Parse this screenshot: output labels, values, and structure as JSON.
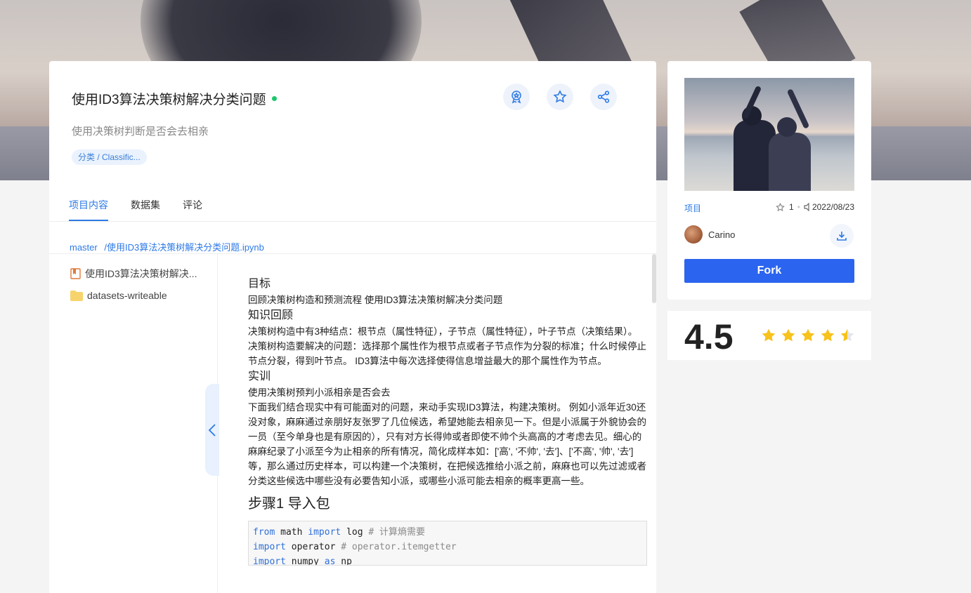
{
  "project": {
    "title": "使用ID3算法决策树解决分类问题",
    "subtitle": "使用决策树判断是否会去相亲",
    "tag": "分类 / Classific...",
    "status_color": "#1bc76b"
  },
  "tabs": [
    {
      "label": "项目内容",
      "active": true
    },
    {
      "label": "数据集",
      "active": false
    },
    {
      "label": "评论",
      "active": false
    }
  ],
  "breadcrumb": {
    "branch": "master",
    "path": "/使用ID3算法决策树解决分类问题.ipynb"
  },
  "file_tree": [
    {
      "icon": "notebook-file-icon",
      "label": "使用ID3算法决策树解决..."
    },
    {
      "icon": "folder-icon",
      "label": "datasets-writeable"
    }
  ],
  "notebook": {
    "h_goal": "目标",
    "goal_text": "回顾决策树构造和预测流程 使用ID3算法决策树解决分类问题",
    "h_knowledge": "知识回顾",
    "knowledge_text": "决策树构造中有3种结点：根节点（属性特征），子节点（属性特征），叶子节点（决策结果）。 决策树构造要解决的问题：选择那个属性作为根节点或者子节点作为分裂的标准；什么时候停止节点分裂，得到叶节点。 ID3算法中每次选择使得信息增益最大的那个属性作为节点。",
    "h_practice": "实训",
    "practice_line": "使用决策树预判小派相亲是否会去",
    "practice_text": "下面我们结合现实中有可能面对的问题，来动手实现ID3算法，构建决策树。 例如小派年近30还没对象，麻麻通过亲朋好友张罗了几位候选，希望她能去相亲见一下。但是小派属于外貌协会的一员（至今单身也是有原因的），只有对方长得帅或者即使不帅个头高高的才考虑去见。细心的麻麻纪录了小派至今为止相亲的所有情况，简化成样本如：['高', '不帅', '去']、['不高', '帅', '去']等，那么通过历史样本，可以构建一个决策树，在把候选推给小派之前，麻麻也可以先过滤或者分类这些候选中哪些没有必要告知小派，或哪些小派可能去相亲的概率更高一些。",
    "h_step1": "步骤1 导入包",
    "code": {
      "l1_kw1": "from",
      "l1_mod": " math ",
      "l1_kw2": "import",
      "l1_name": " log ",
      "l1_cm": "# 计算熵需要",
      "l2_kw1": "import",
      "l2_mod": " operator ",
      "l2_cm": "# operator.itemgetter",
      "l3_kw1": "import",
      "l3_mod": " numpy ",
      "l3_kw2": "as",
      "l3_name": " np"
    }
  },
  "side": {
    "type_label": "项目",
    "star_count": "1",
    "date": "2022/08/23",
    "author": "Carino",
    "fork_label": "Fork"
  },
  "rating": {
    "score": "4.5",
    "value": 4.5,
    "max": 5,
    "star_color": "#f7c21b"
  }
}
